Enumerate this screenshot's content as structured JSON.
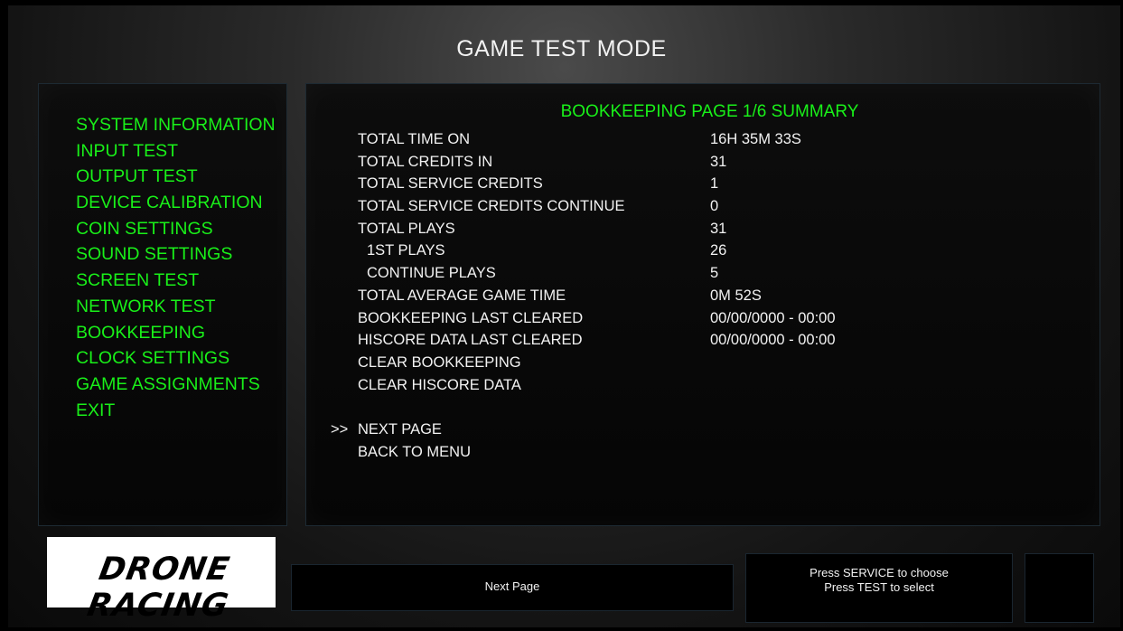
{
  "header": {
    "title": "GAME TEST MODE"
  },
  "menu": {
    "items": [
      "SYSTEM INFORMATION",
      "INPUT TEST",
      "OUTPUT TEST",
      "DEVICE CALIBRATION",
      "COIN SETTINGS",
      "SOUND SETTINGS",
      "SCREEN TEST",
      "NETWORK TEST",
      "BOOKKEEPING",
      "CLOCK SETTINGS",
      "GAME ASSIGNMENTS",
      "EXIT"
    ]
  },
  "page": {
    "heading": "BOOKKEEPING PAGE 1/6 SUMMARY",
    "rows": [
      {
        "label": "TOTAL TIME ON",
        "value": "16H 35M 33S"
      },
      {
        "label": "TOTAL CREDITS IN",
        "value": "31"
      },
      {
        "label": "TOTAL SERVICE CREDITS",
        "value": "1"
      },
      {
        "label": "TOTAL SERVICE CREDITS CONTINUE",
        "value": "0"
      },
      {
        "label": "TOTAL PLAYS",
        "value": "31"
      },
      {
        "label": "1ST PLAYS",
        "value": "26"
      },
      {
        "label": "CONTINUE PLAYS",
        "value": "5"
      },
      {
        "label": "TOTAL AVERAGE GAME TIME",
        "value": "0M 52S"
      },
      {
        "label": "BOOKKEEPING LAST CLEARED",
        "value": "00/00/0000 - 00:00"
      },
      {
        "label": "HISCORE DATA LAST CLEARED",
        "value": "00/00/0000 - 00:00"
      }
    ],
    "actions": [
      "CLEAR BOOKKEEPING",
      "CLEAR HISCORE DATA"
    ],
    "nav": [
      "NEXT PAGE",
      "BACK TO MENU"
    ],
    "cursor": ">>"
  },
  "logo": {
    "text": "DRONE RACING"
  },
  "footer": {
    "selected_label": "Next Page",
    "help_line1": "Press SERVICE to choose",
    "help_line2": "Press TEST to select"
  }
}
